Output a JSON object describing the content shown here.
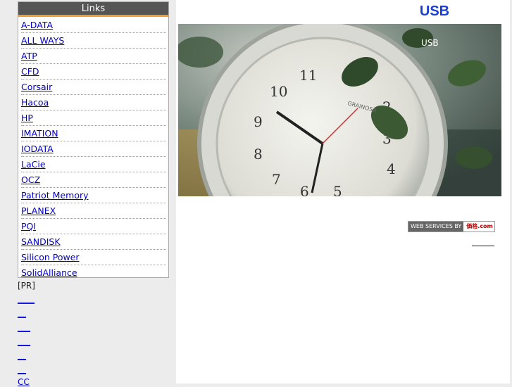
{
  "sidebar": {
    "header": "Links",
    "links": [
      "A-DATA",
      "ALL WAYS",
      "ATP",
      "CFD",
      "Corsair",
      "Hacoa",
      "HP",
      "IMATION",
      "IODATA",
      "LaCie",
      "OCZ",
      "Patriot Memory",
      "PLANEX",
      "PQI",
      "SANDISK",
      "Silicon Power",
      "SolidAlliance"
    ],
    "pr_label": "[PR]",
    "pr_links": [
      "____",
      "__",
      "___",
      "___",
      "__",
      "__",
      "CC"
    ]
  },
  "main": {
    "title": "USB",
    "hero_caption": "USB",
    "badge_left": "WEB SERVICES BY",
    "badge_right": "価格.com"
  }
}
